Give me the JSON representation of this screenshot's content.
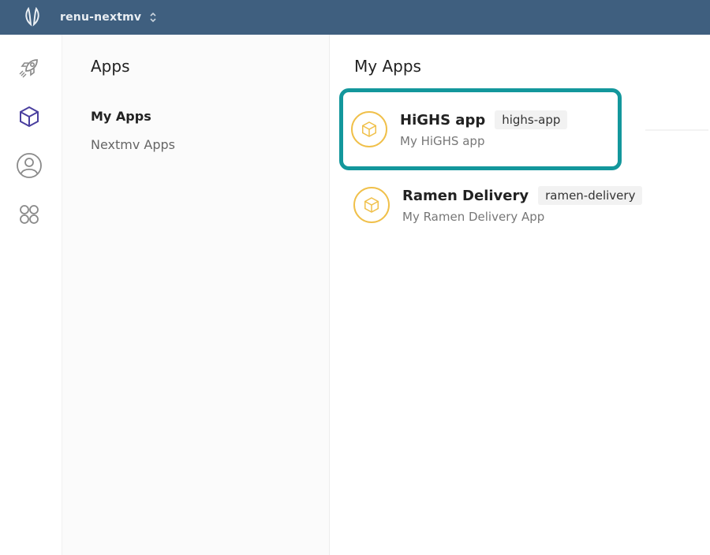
{
  "topbar": {
    "org_name": "renu-nextmv",
    "logo_icon": "rabbit-ears-logo",
    "switch_icon": "chevron-updown-icon"
  },
  "rail": {
    "items": [
      {
        "icon": "rocket-icon",
        "active": false
      },
      {
        "icon": "cube-icon",
        "active": true
      },
      {
        "icon": "user-circle-icon",
        "active": false
      },
      {
        "icon": "grid-circles-icon",
        "active": false
      }
    ]
  },
  "subnav": {
    "title": "Apps",
    "items": [
      {
        "label": "My Apps",
        "active": true
      },
      {
        "label": "Nextmv Apps",
        "active": false
      }
    ]
  },
  "main": {
    "title": "My Apps",
    "apps": [
      {
        "name": "HiGHS app",
        "id": "highs-app",
        "description": "My HiGHS app",
        "icon": "cube-icon",
        "highlighted": true
      },
      {
        "name": "Ramen Delivery",
        "id": "ramen-delivery",
        "description": "My Ramen Delivery App",
        "icon": "cube-icon",
        "highlighted": false
      }
    ]
  },
  "colors": {
    "topbar": "#3f5f7f",
    "accent_active": "#4a3f9f",
    "highlight_border": "#13979c",
    "app_icon": "#f0c04a"
  }
}
